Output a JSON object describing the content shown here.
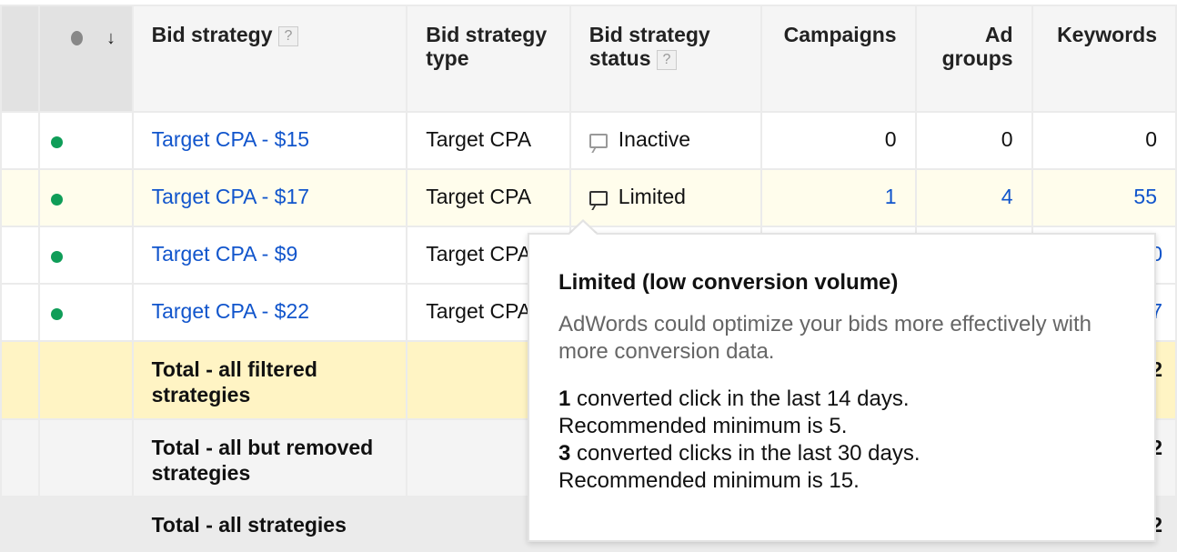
{
  "headers": {
    "bid_strategy": "Bid strategy",
    "type": "Bid strategy type",
    "status": "Bid strategy status",
    "campaigns": "Campaigns",
    "ad_groups": "Ad groups",
    "keywords": "Keywords",
    "help": "?",
    "sort_icon": "arrow-down-icon"
  },
  "rows": [
    {
      "name": "Target CPA - $15",
      "type": "Target CPA",
      "status": "Inactive",
      "campaigns": "0",
      "ad_groups": "0",
      "keywords": "0"
    },
    {
      "name": "Target CPA - $17",
      "type": "Target CPA",
      "status": "Limited",
      "campaigns": "1",
      "ad_groups": "4",
      "keywords": "55"
    },
    {
      "name": "Target CPA - $9",
      "type": "Target CPA",
      "keywords": "0"
    },
    {
      "name": "Target CPA - $22",
      "type": "Target CPA",
      "keywords": "7"
    }
  ],
  "totals": [
    {
      "label": "Total - all filtered strategies",
      "keywords": "2"
    },
    {
      "label": "Total - all but removed strategies",
      "keywords": "2"
    },
    {
      "label": "Total - all strategies",
      "keywords": "2"
    }
  ],
  "tooltip": {
    "title": "Limited (low conversion volume)",
    "description": "AdWords could optimize your bids more effectively with more conversion data.",
    "line1_num": "1",
    "line1_text": " converted click in the last 14 days.",
    "line2": "Recommended minimum is 5.",
    "line3_num": "3",
    "line3_text": " converted clicks in the last 30 days.",
    "line4": "Recommended minimum is 15."
  },
  "colors": {
    "link": "#1155cc",
    "enabled_dot": "#0f9d58",
    "total_row": "#fff4c4",
    "highlight_row": "#fffdec"
  }
}
